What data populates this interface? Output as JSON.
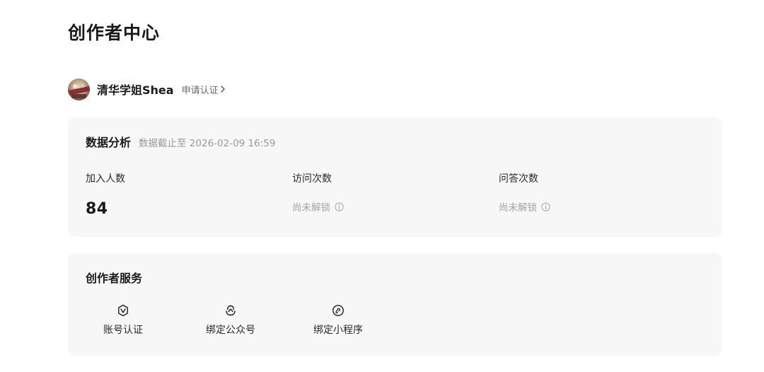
{
  "header": {
    "title": "创作者中心"
  },
  "profile": {
    "username": "清华学姐Shea",
    "certify_link": "申请认证"
  },
  "data_analysis": {
    "title": "数据分析",
    "updated_note": "数据截止至 2026-02-09 16:59",
    "metrics": [
      {
        "label": "加入人数",
        "value": "84"
      },
      {
        "label": "访问次数",
        "value": "尚未解锁"
      },
      {
        "label": "问答次数",
        "value": "尚未解锁"
      }
    ]
  },
  "creator_services": {
    "title": "创作者服务",
    "items": [
      {
        "label": "账号认证",
        "icon": "verified-badge-icon"
      },
      {
        "label": "绑定公众号",
        "icon": "wechat-official-account-icon"
      },
      {
        "label": "绑定小程序",
        "icon": "mini-program-icon"
      }
    ]
  },
  "colors": {
    "card_background": "#f7f7f7",
    "muted_text": "#a6a6a6",
    "primary_text": "#1a1a1a"
  }
}
